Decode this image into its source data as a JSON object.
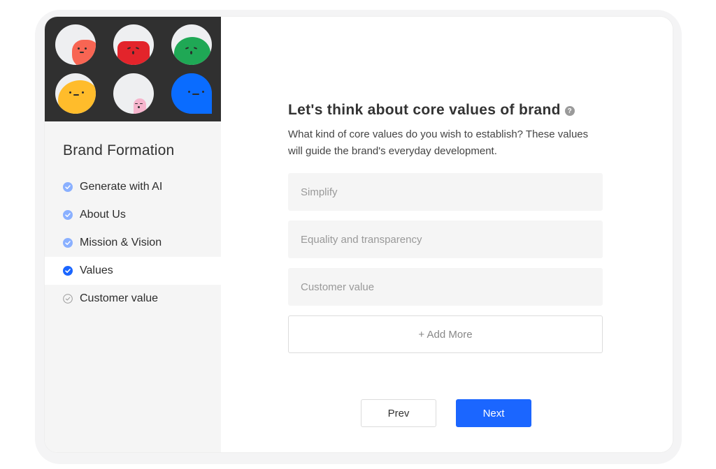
{
  "sidebar": {
    "title": "Brand Formation",
    "avatars": [
      {
        "name": "red-orange-character",
        "color": "#f86553"
      },
      {
        "name": "red-character",
        "color": "#e3242b"
      },
      {
        "name": "green-character",
        "color": "#1fa855"
      },
      {
        "name": "yellow-character",
        "color": "#ffbc2b"
      },
      {
        "name": "pink-character",
        "color": "#f6b5cd"
      },
      {
        "name": "blue-character",
        "color": "#0a6cff"
      }
    ],
    "steps": [
      {
        "label": "Generate with AI",
        "status": "completed"
      },
      {
        "label": "About Us",
        "status": "completed"
      },
      {
        "label": "Mission & Vision",
        "status": "completed"
      },
      {
        "label": "Values",
        "status": "current"
      },
      {
        "label": "Customer value",
        "status": "pending"
      }
    ]
  },
  "main": {
    "heading": "Let's think about core values of brand",
    "help_icon": "question-circle-icon",
    "subtitle": "What kind of core values do you wish to establish? These values will guide the brand's everyday development.",
    "value_fields": [
      {
        "placeholder": "Simplify",
        "value": ""
      },
      {
        "placeholder": "Equality and transparency",
        "value": ""
      },
      {
        "placeholder": "Customer value",
        "value": ""
      }
    ],
    "add_more_label": "+ Add More",
    "prev_label": "Prev",
    "next_label": "Next"
  },
  "colors": {
    "accent": "#1b66ff",
    "completed_step": "#8ab0ff",
    "current_step": "#1b66ff",
    "pending_step": "#9a9a9a",
    "sidebar_bg": "#f5f5f5",
    "avatar_panel_bg": "#303030"
  }
}
